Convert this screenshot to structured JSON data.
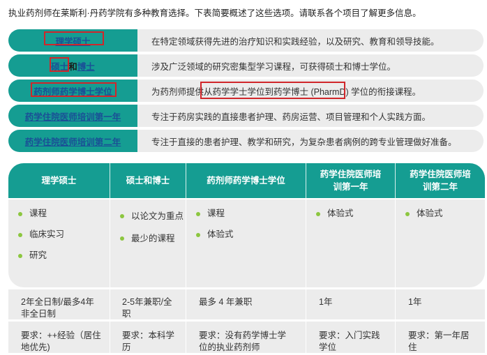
{
  "intro": "执业药剂师在莱斯利·丹药学院有多种教育选择。下表简要概述了这些选项。请联系各个项目了解更多信息。",
  "programs": [
    {
      "label": "理学硕士",
      "description": "在特定领域获得先进的治疗知识和实践经验，以及研究、教育和领导技能。"
    },
    {
      "label_a": "硕士",
      "label_joiner": "和",
      "label_b": "博士",
      "description": "涉及广泛领域的研究密集型学习课程，可获得硕士和博士学位。"
    },
    {
      "label": "药剂师药学博士学位",
      "description": "为药剂师提供从药学学士学位到药学博士 (PharmD) 学位的衔接课程。"
    },
    {
      "label": "药学住院医师培训第一年",
      "description": "专注于药房实践的直接患者护理、药房运营、项目管理和个人实践方面。"
    },
    {
      "label": "药学住院医师培训第二年",
      "description": "专注于直接的患者护理、教学和研究，为复杂患者病例的跨专业管理做好准备。"
    }
  ],
  "table": {
    "headers": [
      {
        "line1": "理学硕士",
        "line2": ""
      },
      {
        "line1": "硕士和博士",
        "line2": ""
      },
      {
        "line1": "药剂师药学博士学位",
        "line2": ""
      },
      {
        "line1": "药学住院医师培",
        "line2": "训第一年"
      },
      {
        "line1": "药学住院医师培",
        "line2": "训第二年"
      }
    ],
    "features": [
      [
        "课程",
        "临床实习",
        "研究"
      ],
      [
        "以论文为重点",
        "最少的课程"
      ],
      [
        "课程",
        "体验式"
      ],
      [
        "体验式"
      ],
      [
        "体验式"
      ]
    ],
    "duration": [
      "2年全日制/最多4年非全日制",
      "2-5年兼职/全职",
      "最多 4 年兼职",
      "1年",
      "1年"
    ],
    "requirements": [
      "要求：++经验（居住地优先)",
      "要求：本科学历",
      "要求：没有药学博士学位的执业药剂师",
      "要求：入门实践学位",
      "要求：第一年居住"
    ]
  },
  "colors": {
    "teal": "#159d92",
    "gray": "#ececec",
    "link": "#1a4f96",
    "bullet": "#8cc63f",
    "highlight": "#d0262a"
  }
}
